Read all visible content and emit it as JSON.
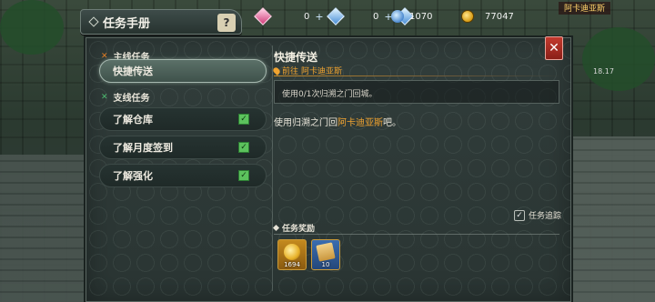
{
  "window": {
    "title": "任务手册",
    "help_icon": "npc-help-icon"
  },
  "topbar": {
    "gem_a_value": "0",
    "gem_b_value": "0",
    "orb_value": "1070",
    "gold_value": "77047",
    "map_name": "阿卡迪亚斯",
    "level_readout": "18.17"
  },
  "sidebar": {
    "main_section": "主线任务",
    "main_items": [
      {
        "label": "快捷传送",
        "active": true
      }
    ],
    "side_section": "支线任务",
    "side_items": [
      {
        "label": "了解仓库",
        "done": true
      },
      {
        "label": "了解月度签到",
        "done": true
      },
      {
        "label": "了解强化",
        "done": true
      }
    ]
  },
  "detail": {
    "title": "快捷传送",
    "location_prefix": "前往",
    "location_name": "阿卡迪亚斯",
    "objective": "使用0/1次归溯之门回城。",
    "desc_before": "使用归溯之门回",
    "desc_highlight": "阿卡迪亚斯",
    "desc_after": "吧。",
    "track_label": "任务追踪",
    "rewards_label": "任务奖励",
    "rewards": [
      {
        "icon": "gold-coin-icon",
        "amount": "1694"
      },
      {
        "icon": "scroll-icon",
        "amount": "10"
      }
    ]
  },
  "colors": {
    "accent": "#f0a330",
    "panel": "#2e3a38",
    "close": "#c43a2e",
    "check": "#5cc25d"
  }
}
